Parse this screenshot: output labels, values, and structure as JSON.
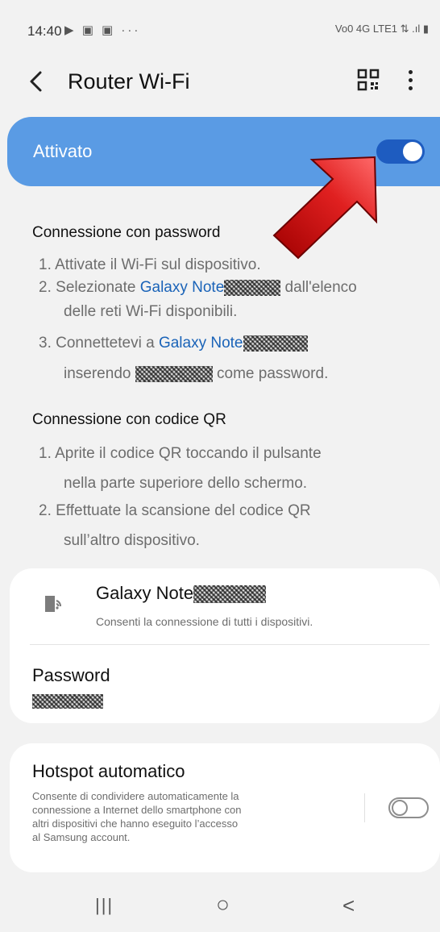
{
  "status_bar": {
    "time": "14:40",
    "left_icons": "▶ ▣ ▣ ···",
    "right_icons": "Vo0 4G LTE1 ⇅ .ıl ▮"
  },
  "app_bar": {
    "back_icon": "chevron-left",
    "title": "Router Wi-Fi",
    "qr_icon": "qr-code",
    "more_icon": "more-vertical"
  },
  "master_switch": {
    "label": "Attivato",
    "state": "on",
    "color": "#5a9be4"
  },
  "password_section": {
    "heading": "Connessione con password",
    "items": [
      {
        "num": "1.",
        "text": "Attivate il Wi-Fi sul dispositivo."
      },
      {
        "num": "2.",
        "pre": "Selezionate ",
        "link": "Galaxy Note",
        "post": " dall'elenco",
        "line2": "delle reti Wi-Fi disponibili."
      },
      {
        "num": "3.",
        "pre": "Connettetevi a ",
        "link": "Galaxy Note",
        "line2_pre": "inserendo ",
        "line2_post": " come password."
      }
    ]
  },
  "qr_section": {
    "heading": "Connessione con codice QR",
    "items": [
      {
        "num": "1.",
        "line1": "Aprite il codice QR toccando il pulsante",
        "line2": "nella parte superiore dello schermo."
      },
      {
        "num": "2.",
        "line1": "Effettuate la scansione del codice QR",
        "line2": "sull’altro dispositivo."
      }
    ]
  },
  "network_card": {
    "name": "Galaxy Note",
    "subtitle": "Consenti la connessione di tutti i dispositivi.",
    "password_label": "Password"
  },
  "auto_hotspot": {
    "title": "Hotspot automatico",
    "description_lines": [
      "Consente di condividere automaticamente la",
      "connessione a Internet dello smartphone con",
      "altri dispositivi che hanno eseguito l’accesso",
      "al Samsung account."
    ],
    "state": "off"
  },
  "nav_bar": {
    "recents": "|||",
    "home": "○",
    "back": "<"
  }
}
